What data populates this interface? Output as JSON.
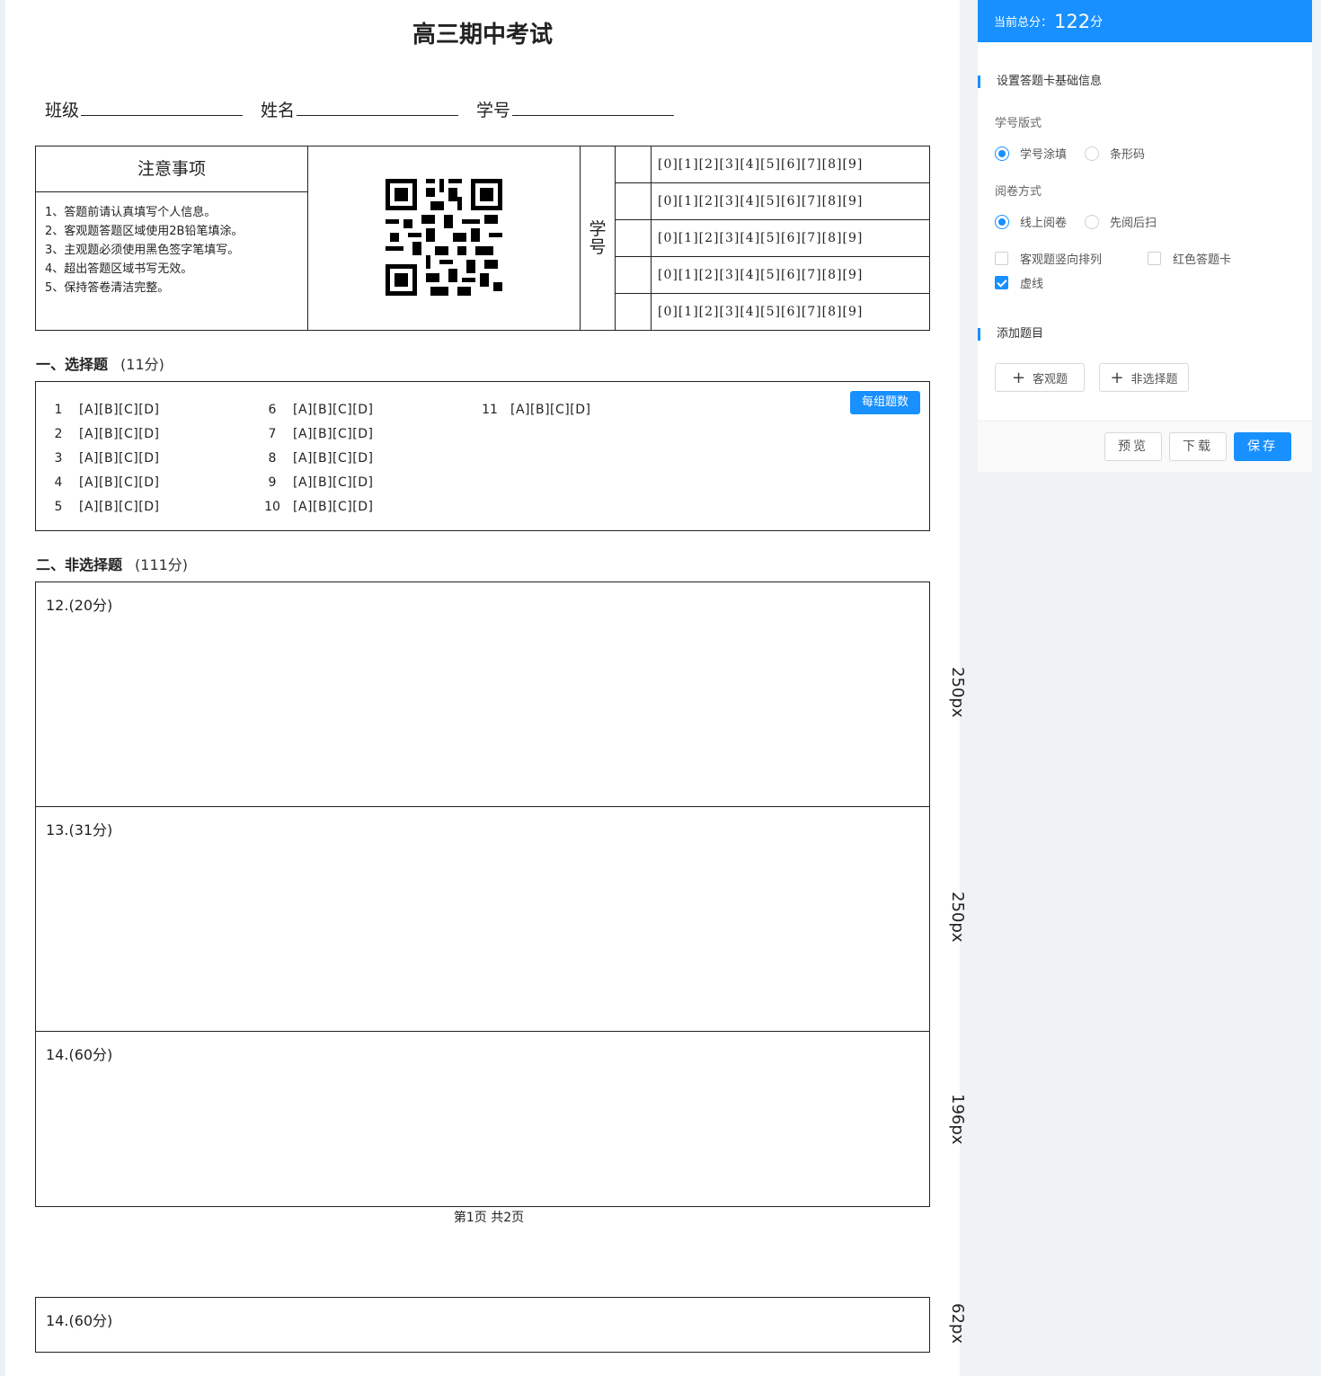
{
  "sheet": {
    "title": "高三期中考试",
    "fields": [
      "班级",
      "姓名",
      "学号"
    ],
    "notice": {
      "title": "注意事项",
      "items": [
        "1、答题前请认真填写个人信息。",
        "2、客观题答题区域使用2B铅笔填涂。",
        "3、主观题必须使用黑色签字笔填写。",
        "4、超出答题区域书写无效。",
        "5、保持答卷清洁完整。"
      ]
    },
    "student_id_label": "学号",
    "digit_row": "[0][1][2][3][4][5][6][7][8][9]",
    "section1": {
      "title": "一、选择题",
      "score": "(11分)"
    },
    "mc_questions": [
      {
        "n": "1",
        "opts": "[A][B][C][D]"
      },
      {
        "n": "2",
        "opts": "[A][B][C][D]"
      },
      {
        "n": "3",
        "opts": "[A][B][C][D]"
      },
      {
        "n": "4",
        "opts": "[A][B][C][D]"
      },
      {
        "n": "5",
        "opts": "[A][B][C][D]"
      },
      {
        "n": "6",
        "opts": "[A][B][C][D]"
      },
      {
        "n": "7",
        "opts": "[A][B][C][D]"
      },
      {
        "n": "8",
        "opts": "[A][B][C][D]"
      },
      {
        "n": "9",
        "opts": "[A][B][C][D]"
      },
      {
        "n": "10",
        "opts": "[A][B][C][D]"
      },
      {
        "n": "11",
        "opts": "[A][B][C][D]"
      }
    ],
    "per_group_button": "每组题数",
    "section2": {
      "title": "二、非选择题",
      "score": "(111分)"
    },
    "answer_boxes": [
      {
        "label": "12.(20分)",
        "height_label": "250px"
      },
      {
        "label": "13.(31分)",
        "height_label": "250px"
      },
      {
        "label": "14.(60分)",
        "height_label": "196px"
      },
      {
        "label": "14.(60分)",
        "height_label": "62px"
      }
    ],
    "page_number": "第1页 共2页"
  },
  "panel": {
    "score_label": "当前总分：",
    "score_value": "122",
    "score_unit": "分",
    "basic_title": "设置答题卡基础信息",
    "id_format_label": "学号版式",
    "id_format_options": [
      "学号涂填",
      "条形码"
    ],
    "id_format_selected": "学号涂填",
    "review_label": "阅卷方式",
    "review_options": [
      "线上阅卷",
      "先阅后扫"
    ],
    "review_selected": "线上阅卷",
    "checkboxes": [
      {
        "label": "客观题竖向排列",
        "checked": false
      },
      {
        "label": "红色答题卡",
        "checked": false
      },
      {
        "label": "虚线",
        "checked": true
      }
    ],
    "add_title": "添加题目",
    "add_objective": "客观题",
    "add_subjective": "非选择题",
    "preview": "预览",
    "download": "下载",
    "save": "保存",
    "accent_color": "#1890ff"
  }
}
